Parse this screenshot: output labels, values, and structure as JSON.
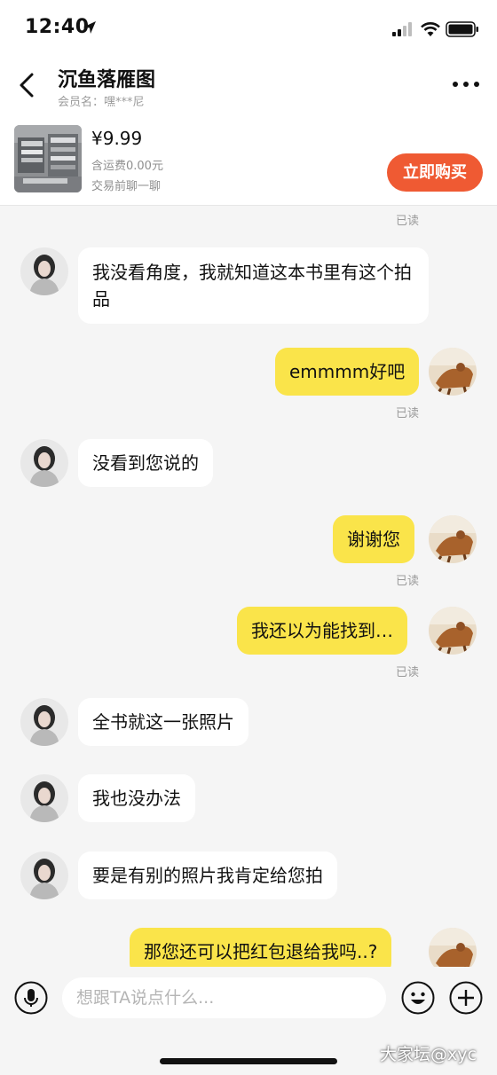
{
  "status_bar": {
    "time": "12:40"
  },
  "header": {
    "title": "沉鱼落雁图",
    "subtitle": "会员名：嘿***尼"
  },
  "product": {
    "price": "¥9.99",
    "shipping": "含运费0.00元",
    "chat_hint": "交易前聊一聊",
    "buy_label": "立即购买",
    "buy_color": "#ef5a33"
  },
  "messages": [
    {
      "side": "in",
      "text": "我没看角度，我就知道这本书里有这个拍品"
    },
    {
      "side": "out",
      "text": "emmmm好吧",
      "read": "已读"
    },
    {
      "side": "in",
      "text": "没看到您说的"
    },
    {
      "side": "out",
      "text": "谢谢您",
      "read": "已读"
    },
    {
      "side": "out",
      "text": "我还以为能找到…",
      "read": "已读"
    },
    {
      "side": "in",
      "text": "全书就这一张照片"
    },
    {
      "side": "in",
      "text": "我也没办法"
    },
    {
      "side": "in",
      "text": "要是有别的照片我肯定给您拍"
    },
    {
      "side": "out",
      "text": "那您还可以把红包退给我吗..?"
    }
  ],
  "top_read": "已读",
  "input": {
    "placeholder": "想跟TA说点什么..."
  },
  "watermark": "大家坛@xyc",
  "colors": {
    "outgoing_bubble": "#fae44a",
    "incoming_bubble": "#ffffff",
    "background": "#f5f5f5"
  }
}
